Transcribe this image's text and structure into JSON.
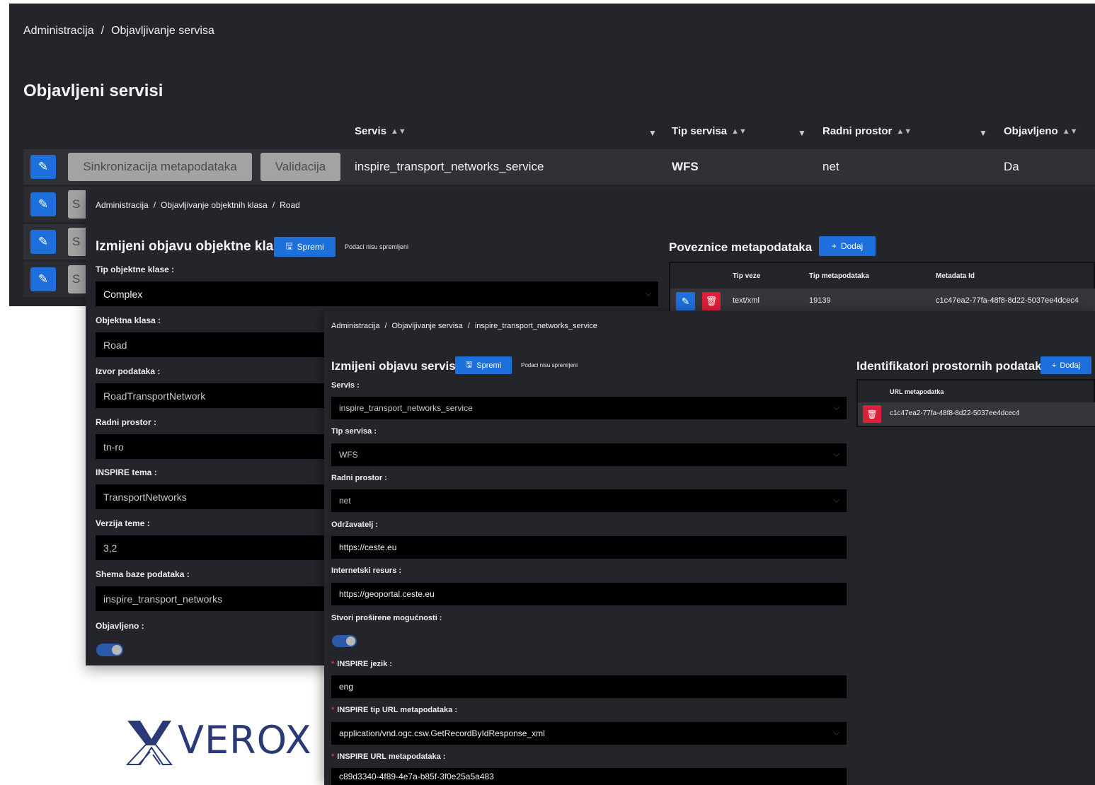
{
  "colors": {
    "panel_bg": "#23252a",
    "row_bg": "#2f3136",
    "field_bg": "#000000",
    "primary": "#1d6fdc",
    "danger": "#dc1f3a",
    "secondary_btn": "#a3a3a3",
    "logo": "#2a3a78"
  },
  "services_page": {
    "breadcrumb": [
      "Administracija",
      "Objavljivanje servisa"
    ],
    "title": "Objavljeni servisi",
    "columns": [
      "Servis",
      "Tip servisa",
      "Radni prostor",
      "Objavljeno"
    ],
    "row_buttons": {
      "sync": "Sinkronizacija metapodataka",
      "validate": "Validacija"
    },
    "rows": [
      {
        "service": "inspire_transport_networks_service",
        "type": "WFS",
        "workspace": "net",
        "published": "Da"
      }
    ],
    "sync_partial": "S"
  },
  "feature_class_page": {
    "breadcrumb": [
      "Administracija",
      "Objavljivanje objektnih klasa",
      "Road"
    ],
    "title": "Izmijeni objavu objektne klase",
    "save_label": "Spremi",
    "unsaved_label": "Podaci nisu spremljeni",
    "fields": {
      "type_label": "Tip objektne klase :",
      "type_value": "Complex",
      "class_label": "Objektna klasa :",
      "class_value": "Road",
      "source_label": "Izvor podataka :",
      "source_value": "RoadTransportNetwork",
      "workspace_label": "Radni prostor :",
      "workspace_value": "tn-ro",
      "theme_label": "INSPIRE tema :",
      "theme_value": "TransportNetworks",
      "theme_version_label": "Verzija teme :",
      "theme_version_value": "3,2",
      "schema_label": "Shema baze podataka :",
      "schema_value": "inspire_transport_networks",
      "published_label": "Objavljeno :"
    },
    "metadata_links": {
      "title": "Poveznice metapodataka",
      "add_label": "Dodaj",
      "columns": [
        "Tip veze",
        "Tip metapodataka",
        "Metadata Id"
      ],
      "rows": [
        {
          "link_type": "text/xml",
          "metadata_type": "19139",
          "metadata_id": "c1c47ea2-77fa-48f8-8d22-5037ee4dcec4"
        }
      ]
    }
  },
  "service_edit_page": {
    "breadcrumb": [
      "Administracija",
      "Objavljivanje servisa",
      "inspire_transport_networks_service"
    ],
    "title": "Izmijeni objavu servisa",
    "save_label": "Spremi",
    "unsaved_label": "Podaci nisu spremljeni",
    "fields": {
      "service_label": "Servis :",
      "service_value": "inspire_transport_networks_service",
      "type_label": "Tip servisa :",
      "type_value": "WFS",
      "workspace_label": "Radni prostor :",
      "workspace_value": "net",
      "maintainer_label": "Održavatelj :",
      "maintainer_value": "https://ceste.eu",
      "resource_label": "Internetski resurs :",
      "resource_value": "https://geoportal.ceste.eu",
      "extended_label": "Stvori proširene mogućnosti :",
      "language_label": "INSPIRE jezik :",
      "language_value": "eng",
      "url_type_label": "INSPIRE tip URL metapodataka :",
      "url_type_value": "application/vnd.ogc.csw.GetRecordByIdResponse_xml",
      "url_label": "INSPIRE URL metapodataka :",
      "url_value": "c89d3340-4f89-4e7a-b85f-3f0e25a5a483"
    },
    "spatial_ids": {
      "title": "Identifikatori prostornih podataka",
      "add_label": "Dodaj",
      "column": "URL metapodatka",
      "rows": [
        {
          "url": "c1c47ea2-77fa-48f8-8d22-5037ee4dcec4"
        }
      ]
    }
  },
  "logo": {
    "text": "VEROX"
  }
}
